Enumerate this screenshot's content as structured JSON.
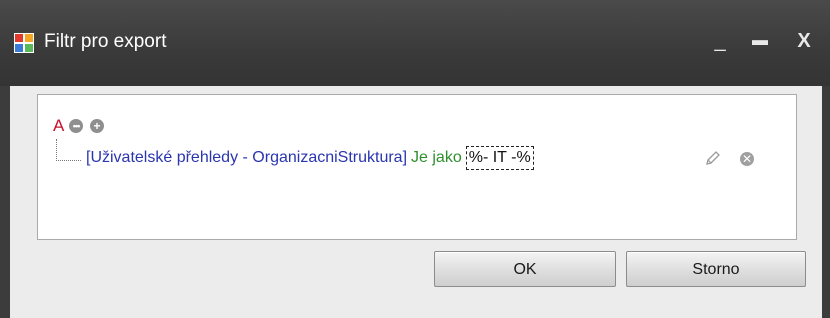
{
  "window": {
    "title": "Filtr pro export",
    "app_icon": "window-app-icon",
    "minimize_glyph": "_",
    "maximize_glyph": "▬",
    "close_glyph": "X"
  },
  "filter": {
    "group_operator": "A",
    "group_menu_icon": "ellipsis-icon",
    "add_condition_icon": "plus-icon",
    "condition": {
      "field": "[Uživatelské přehledy - OrganizacniStruktura]",
      "operator": "Je jako",
      "value": "%- IT -%",
      "edit_icon": "pencil-icon",
      "remove_icon": "remove-icon"
    }
  },
  "buttons": {
    "ok": "OK",
    "cancel": "Storno"
  },
  "colors": {
    "titlebar": "#3c3c3c",
    "group_operator": "#c8102e",
    "field": "#2a35b0",
    "operator": "#2f8f2f"
  }
}
